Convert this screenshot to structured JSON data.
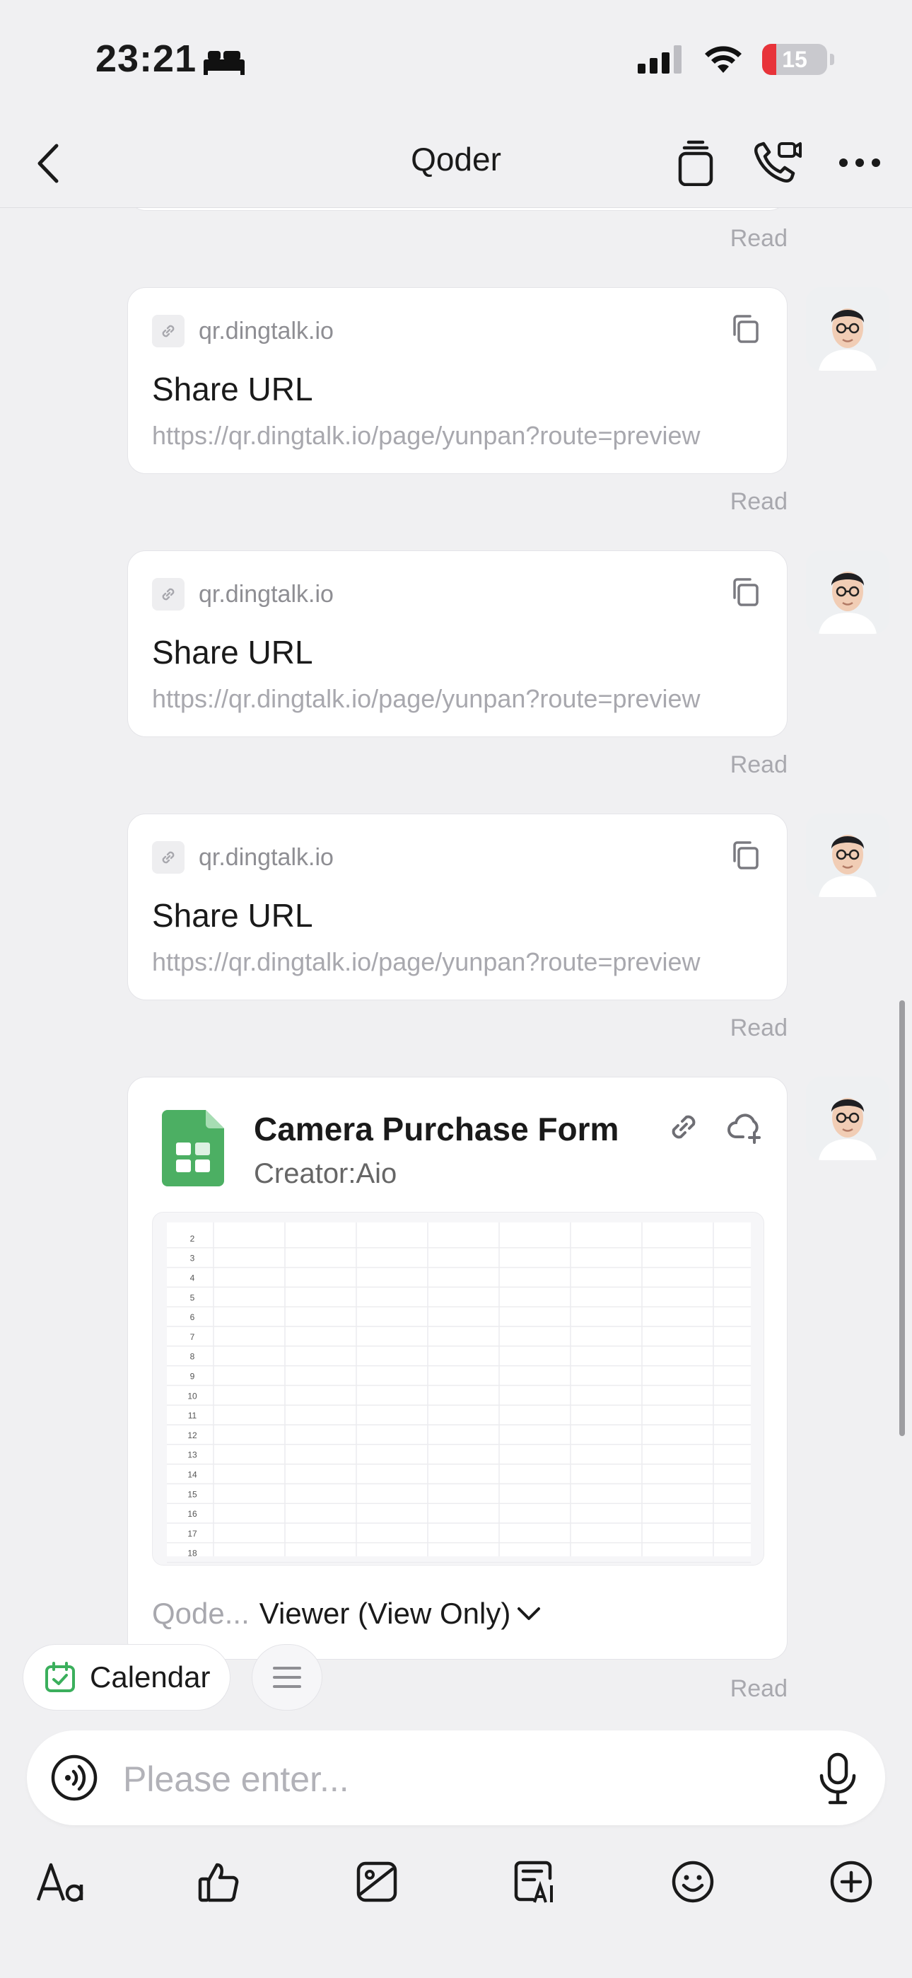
{
  "status_bar": {
    "time": "23:21",
    "battery": "15"
  },
  "nav": {
    "title": "Qoder"
  },
  "messages": [
    {
      "type": "link",
      "domain": "qr.dingtalk.io",
      "title": "Share URL",
      "url": "https://qr.dingtalk.io/page/yunpan?route=preview",
      "status": "Read"
    },
    {
      "type": "link",
      "domain": "qr.dingtalk.io",
      "title": "Share URL",
      "url": "https://qr.dingtalk.io/page/yunpan?route=preview",
      "status": "Read"
    },
    {
      "type": "link",
      "domain": "qr.dingtalk.io",
      "title": "Share URL",
      "url": "https://qr.dingtalk.io/page/yunpan?route=preview",
      "status": "Read"
    }
  ],
  "prev_status": "Read",
  "doc": {
    "title": "Camera Purchase Form",
    "creator": "Creator:Aio",
    "org": "Qode...",
    "permission": "Viewer (View Only)",
    "status": "Read",
    "row_numbers": [
      "2",
      "3",
      "4",
      "5",
      "6",
      "7",
      "8",
      "9",
      "10",
      "11",
      "12",
      "13",
      "14",
      "15",
      "16",
      "17",
      "18"
    ]
  },
  "chips": {
    "calendar": "Calendar"
  },
  "input": {
    "placeholder": "Please enter..."
  },
  "colors": {
    "accent_green": "#4CAF63",
    "red_battery": "#E8333A"
  }
}
